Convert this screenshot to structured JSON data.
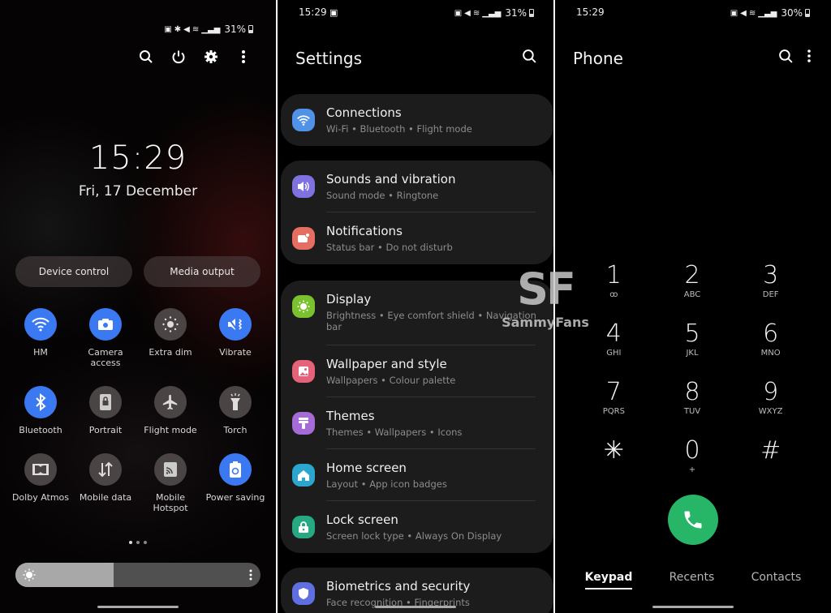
{
  "quick_panel": {
    "status": {
      "battery": "31%"
    },
    "clock": "15:29",
    "date": "Fri, 17 December",
    "buttons": {
      "device_control": "Device control",
      "media_output": "Media output"
    },
    "tiles": [
      {
        "label": "HM",
        "icon": "wifi-icon",
        "on": true
      },
      {
        "label": "Camera access",
        "icon": "camera-icon",
        "on": true
      },
      {
        "label": "Extra dim",
        "icon": "extra-dim-icon",
        "on": false
      },
      {
        "label": "Vibrate",
        "icon": "vibrate-icon",
        "on": true
      },
      {
        "label": "Bluetooth",
        "icon": "bluetooth-icon",
        "on": true
      },
      {
        "label": "Portrait",
        "icon": "portrait-lock-icon",
        "on": false
      },
      {
        "label": "Flight mode",
        "icon": "airplane-icon",
        "on": false
      },
      {
        "label": "Torch",
        "icon": "torch-icon",
        "on": false
      },
      {
        "label": "Dolby Atmos",
        "icon": "dolby-icon",
        "on": false
      },
      {
        "label": "Mobile data",
        "icon": "mobile-data-icon",
        "on": false
      },
      {
        "label": "Mobile Hotspot",
        "icon": "hotspot-icon",
        "on": false
      },
      {
        "label": "Power saving",
        "icon": "power-saving-icon",
        "on": true
      }
    ],
    "page_indicator": {
      "current": 1,
      "total": 3
    },
    "brightness": 0.4
  },
  "settings": {
    "status": {
      "time": "15:29",
      "battery": "31%"
    },
    "title": "Settings",
    "groups": [
      [
        {
          "title": "Connections",
          "subtitle": "Wi-Fi  •  Bluetooth  •  Flight mode",
          "color": "#4f92e6",
          "icon": "wifi-icon"
        }
      ],
      [
        {
          "title": "Sounds and vibration",
          "subtitle": "Sound mode  •  Ringtone",
          "color": "#7d72e0",
          "icon": "speaker-icon"
        },
        {
          "title": "Notifications",
          "subtitle": "Status bar  •  Do not disturb",
          "color": "#e66d62",
          "icon": "notification-icon"
        }
      ],
      [
        {
          "title": "Display",
          "subtitle": "Brightness  •  Eye comfort shield  •  Navigation bar",
          "color": "#7bc12f",
          "icon": "sun-icon"
        },
        {
          "title": "Wallpaper and style",
          "subtitle": "Wallpapers  •  Colour palette",
          "color": "#e4637a",
          "icon": "wallpaper-icon"
        },
        {
          "title": "Themes",
          "subtitle": "Themes  •  Wallpapers  •  Icons",
          "color": "#a56bd6",
          "icon": "brush-icon"
        },
        {
          "title": "Home screen",
          "subtitle": "Layout  •  App icon badges",
          "color": "#2aa6cf",
          "icon": "home-icon"
        },
        {
          "title": "Lock screen",
          "subtitle": "Screen lock type  •  Always On Display",
          "color": "#26a882",
          "icon": "lock-icon"
        }
      ],
      [
        {
          "title": "Biometrics and security",
          "subtitle": "Face recognition  •  Fingerprints",
          "color": "#5f6fe0",
          "icon": "shield-icon"
        }
      ]
    ]
  },
  "watermark": {
    "logo": "SF",
    "name": "SammyFans"
  },
  "phone": {
    "status": {
      "time": "15:29",
      "battery": "30%"
    },
    "title": "Phone",
    "keys": [
      {
        "n": "1",
        "l": "ꝏ"
      },
      {
        "n": "2",
        "l": "ABC"
      },
      {
        "n": "3",
        "l": "DEF"
      },
      {
        "n": "4",
        "l": "GHI"
      },
      {
        "n": "5",
        "l": "JKL"
      },
      {
        "n": "6",
        "l": "MNO"
      },
      {
        "n": "7",
        "l": "PQRS"
      },
      {
        "n": "8",
        "l": "TUV"
      },
      {
        "n": "9",
        "l": "WXYZ"
      },
      {
        "n": "✳",
        "l": ""
      },
      {
        "n": "0",
        "l": "+"
      },
      {
        "n": "#",
        "l": ""
      }
    ],
    "tabs": [
      {
        "label": "Keypad",
        "active": true
      },
      {
        "label": "Recents",
        "active": false
      },
      {
        "label": "Contacts",
        "active": false
      }
    ]
  }
}
